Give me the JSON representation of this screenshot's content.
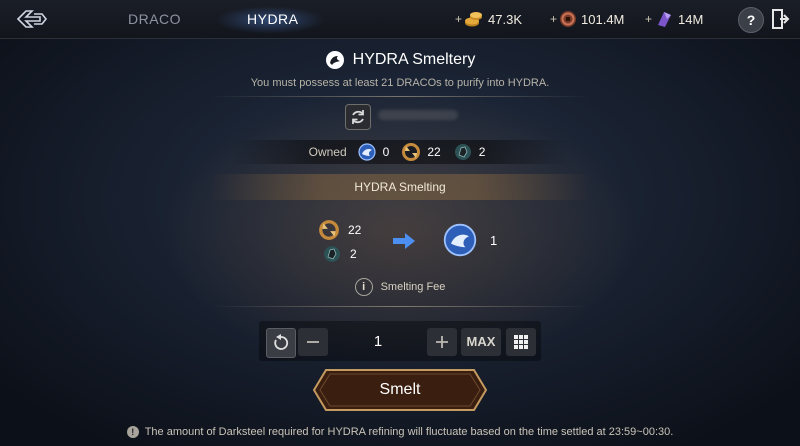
{
  "header": {
    "tabs": [
      {
        "label": "DRACO",
        "active": false
      },
      {
        "label": "HYDRA",
        "active": true
      }
    ],
    "currencies": [
      {
        "icon": "gold-coins-icon",
        "value": "47.3K"
      },
      {
        "icon": "copper-coin-icon",
        "value": "101.4M"
      },
      {
        "icon": "purple-crystal-icon",
        "value": "14M"
      }
    ],
    "plus_symbol": "+",
    "help_label": "?"
  },
  "panel": {
    "title": "HYDRA Smeltery",
    "subtitle": "You must possess at least 21 DRACOs to purify into HYDRA.",
    "owned_label": "Owned",
    "owned": [
      {
        "icon": "hydra-orb-icon",
        "value": "0"
      },
      {
        "icon": "dragon-fang-icon",
        "value": "22"
      },
      {
        "icon": "darksteel-ore-icon",
        "value": "2"
      }
    ],
    "section_title": "HYDRA Smelting",
    "ingredients": [
      {
        "icon": "dragon-fang-icon",
        "value": "22"
      },
      {
        "icon": "darksteel-ore-icon",
        "value": "2"
      }
    ],
    "result": {
      "icon": "hydra-orb-icon",
      "value": "1"
    },
    "fee_label": "Smelting Fee"
  },
  "quantity": {
    "value": "1",
    "max_label": "MAX"
  },
  "smelt_label": "Smelt",
  "footer_note": "The amount of Darksteel required for HYDRA refining will fluctuate based on the time settled at 23:59~00:30.",
  "colors": {
    "accent_gold": "#c59a61",
    "hydra_blue": "#3f7fd8",
    "smelt_button": "#3b2012"
  }
}
